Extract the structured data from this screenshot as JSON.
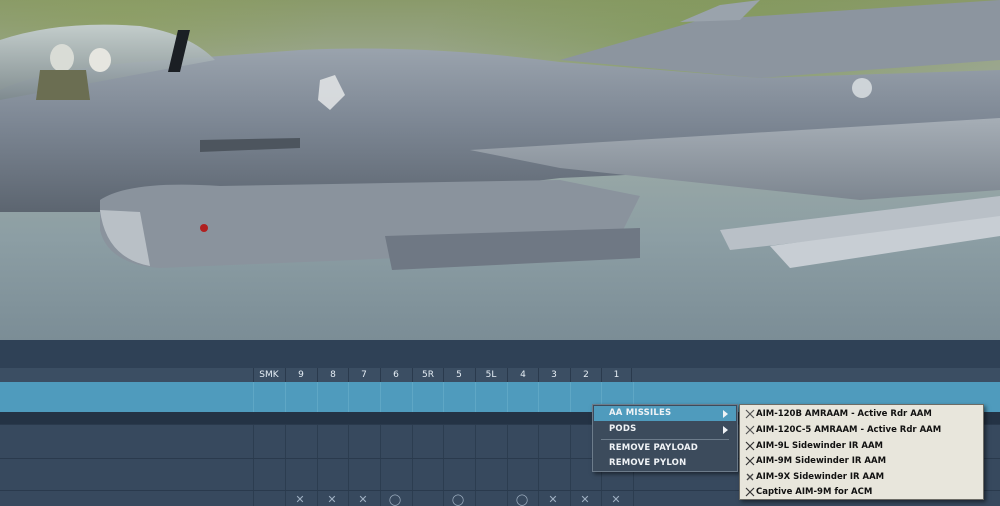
{
  "stations": [
    "SMK",
    "9",
    "8",
    "7",
    "6",
    "5R",
    "5",
    "5L",
    "4",
    "3",
    "2",
    "1"
  ],
  "context_menu": {
    "items": [
      {
        "label": "AA MISSILES",
        "has_submenu": true,
        "active": true
      },
      {
        "label": "PODS",
        "has_submenu": true,
        "active": false
      },
      {
        "label": "REMOVE PAYLOAD",
        "has_submenu": false,
        "active": false
      },
      {
        "label": "REMOVE PYLON",
        "has_submenu": false,
        "active": false
      }
    ]
  },
  "submenu": {
    "items": [
      {
        "label": "AIM-120B AMRAAM - Active Rdr AAM",
        "icon": "missile-icon"
      },
      {
        "label": "AIM-120C-5 AMRAAM - Active Rdr AAM",
        "icon": "missile-icon"
      },
      {
        "label": "AIM-9L Sidewinder IR AAM",
        "icon": "missile-icon"
      },
      {
        "label": "AIM-9M Sidewinder IR AAM",
        "icon": "missile-icon"
      },
      {
        "label": "AIM-9X Sidewinder IR AAM",
        "icon": "missile-icon"
      },
      {
        "label": "Captive AIM-9M for ACM",
        "icon": "missile-icon"
      }
    ]
  },
  "colors": {
    "selected_row": "#4f9bbd",
    "menu_bg": "#3c4b5c",
    "submenu_bg": "#e8e6dc"
  }
}
